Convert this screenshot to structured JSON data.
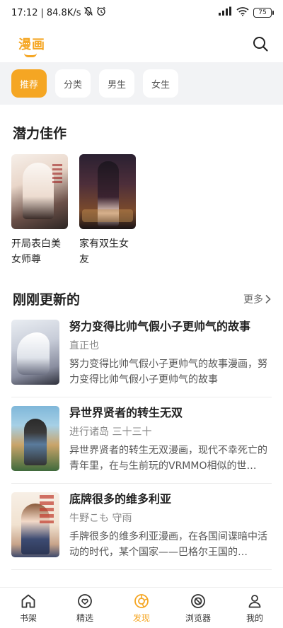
{
  "status_bar": {
    "time": "17:12",
    "network_speed": "84.8K/s",
    "battery": "75"
  },
  "header": {
    "title": "漫画"
  },
  "tabs": [
    {
      "label": "推荐",
      "active": true
    },
    {
      "label": "分类",
      "active": false
    },
    {
      "label": "男生",
      "active": false
    },
    {
      "label": "女生",
      "active": false
    }
  ],
  "potential": {
    "title": "潜力佳作",
    "items": [
      {
        "title": "开局表白美女师尊"
      },
      {
        "title": "家有双生女友"
      }
    ]
  },
  "updated": {
    "title": "刚刚更新的",
    "more_label": "更多",
    "items": [
      {
        "title": "努力变得比帅气假小子更帅气的故事",
        "author": "直正也",
        "description": "努力变得比帅气假小子更帅气的故事漫画，努力变得比帅气假小子更帅气的故事"
      },
      {
        "title": "异世界贤者的转生无双",
        "author": "进行诸岛 三十三十",
        "description": "异世界贤者的转生无双漫画，现代不幸死亡的青年里，在与生前玩的VRMMO相似的世…"
      },
      {
        "title": "底牌很多的维多利亚",
        "author": "牛野こも 守雨",
        "description": "手牌很多的维多利亚漫画，在各国间谍暗中活动的时代，某个国家——巴格尔王国的…"
      }
    ]
  },
  "bottom_nav": {
    "accent_color": "#f5a623",
    "items": [
      {
        "label": "书架",
        "icon": "home-icon",
        "active": false
      },
      {
        "label": "精选",
        "icon": "heart-badge-icon",
        "active": false
      },
      {
        "label": "发现",
        "icon": "compass-icon",
        "active": true
      },
      {
        "label": "浏览器",
        "icon": "browser-icon",
        "active": false
      },
      {
        "label": "我的",
        "icon": "person-icon",
        "active": false
      }
    ]
  }
}
